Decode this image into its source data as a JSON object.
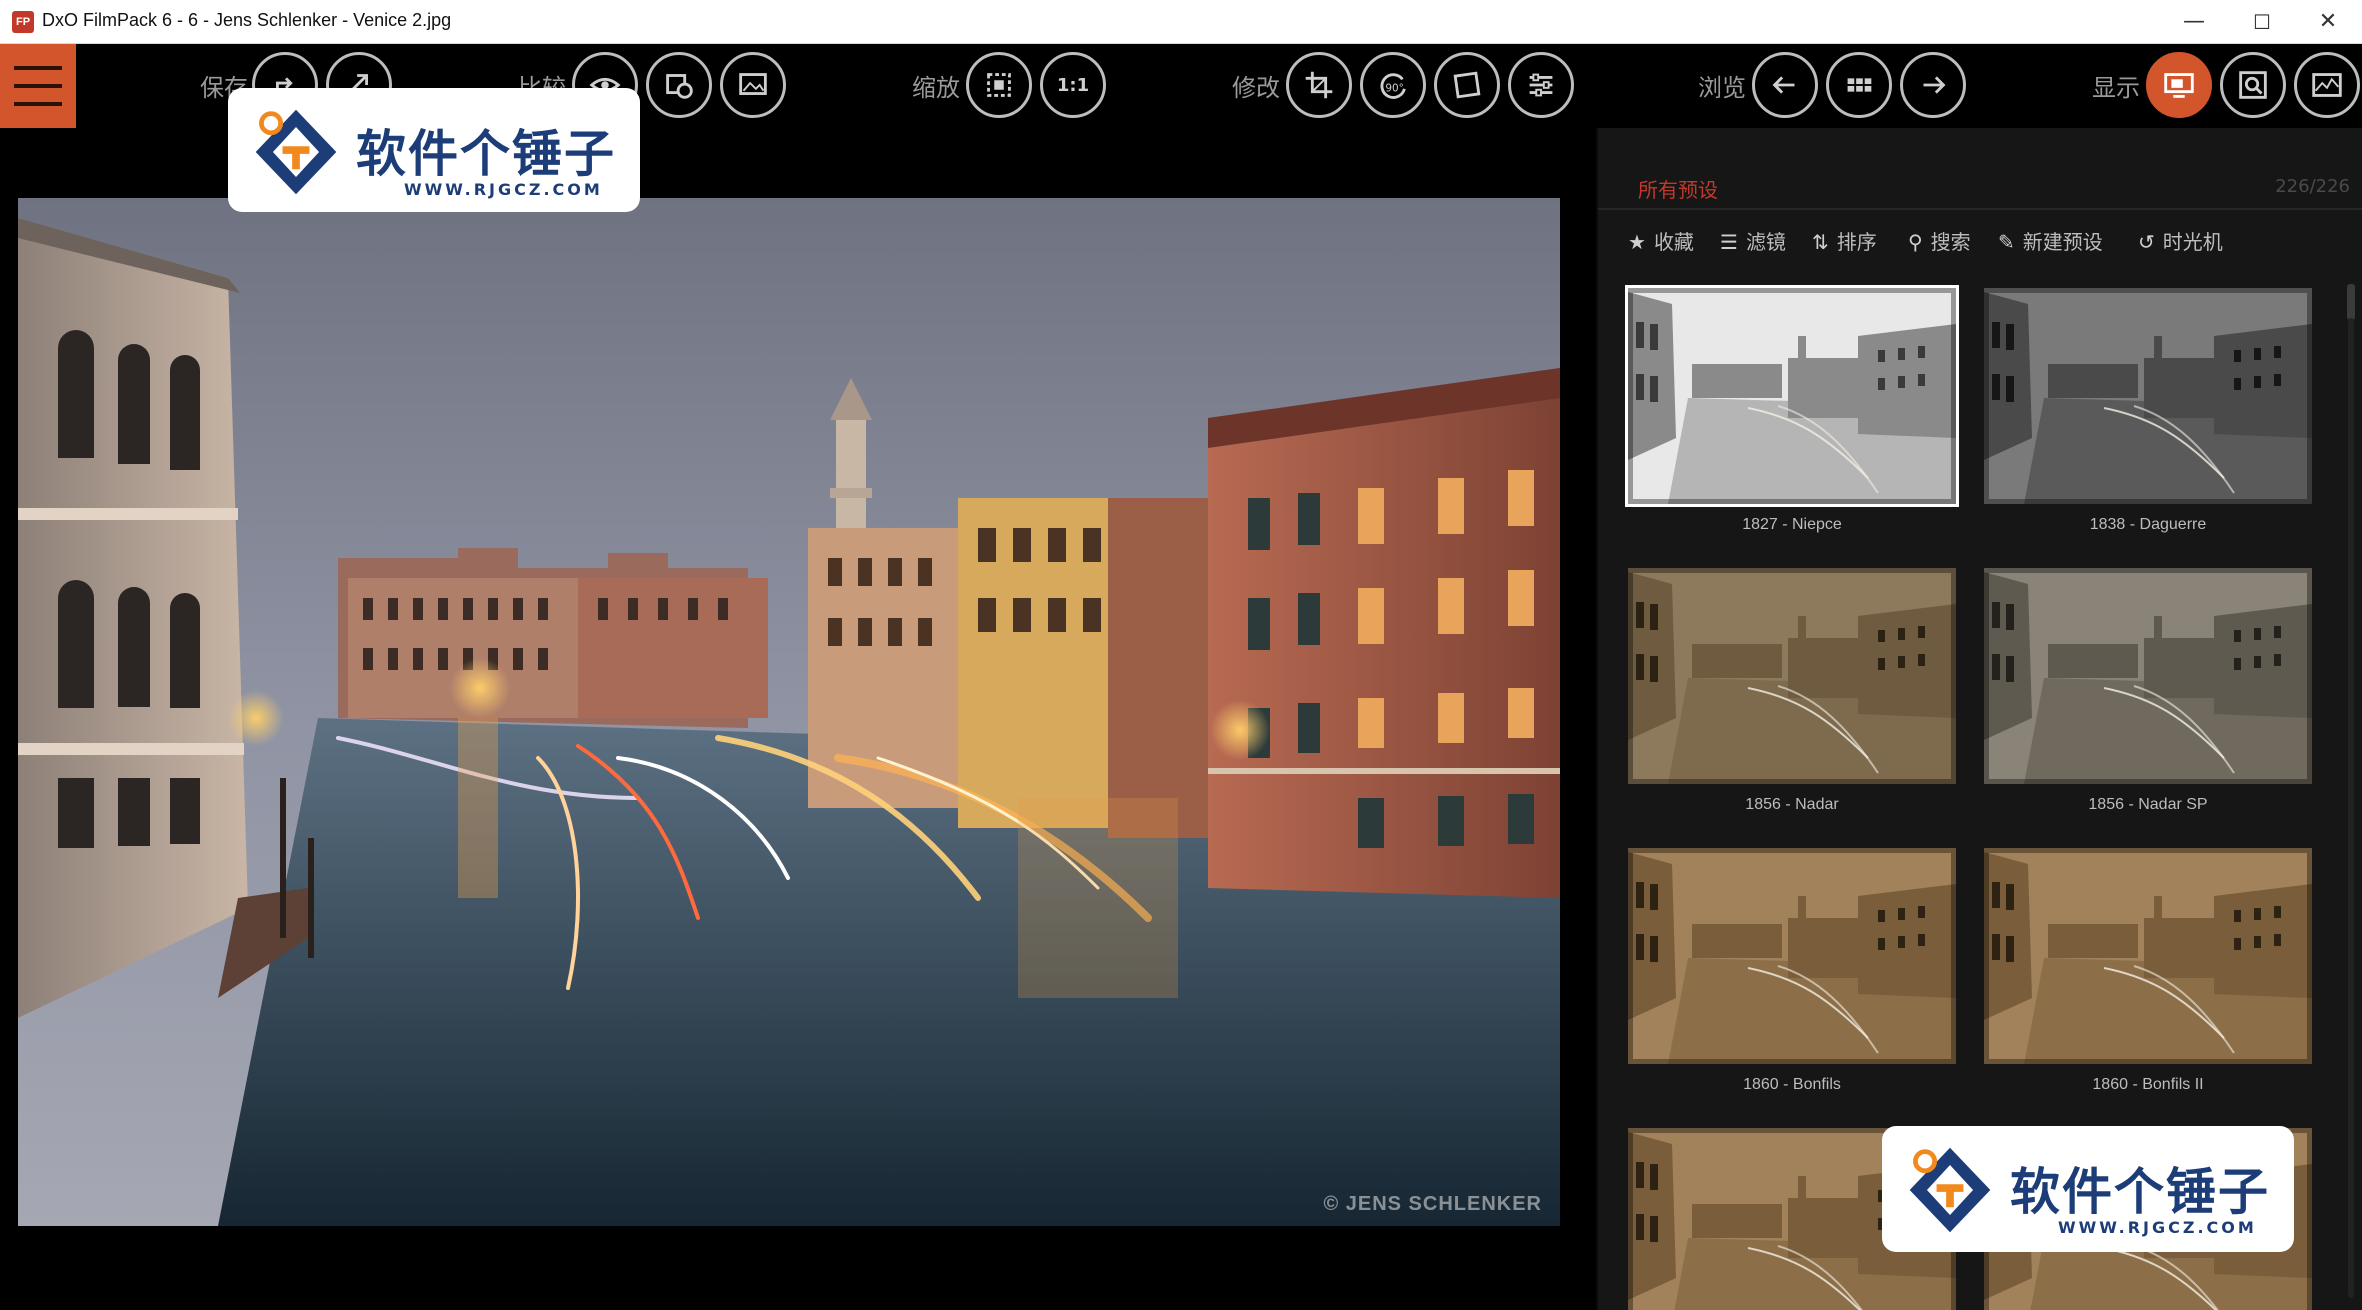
{
  "window": {
    "app_icon": "FP",
    "title": "DxO FilmPack 6 - 6 - Jens Schlenker - Venice 2.jpg",
    "minimize": "—",
    "maximize": "☐",
    "close": "✕"
  },
  "toolbar": {
    "menu_icon": "hamburger-icon",
    "groups": {
      "save": "保存",
      "compare": "比较",
      "zoom": "缩放",
      "modify": "修改",
      "browse": "浏览",
      "display": "显示"
    },
    "zoom_one_to_one": "1:1",
    "rotate_label": "90°",
    "accent_color": "#d2552b"
  },
  "watermark": {
    "text": "软件个锤子",
    "url": "WWW.RJGCZ.COM"
  },
  "photo": {
    "credit": "© JENS SCHLENKER"
  },
  "presets_panel": {
    "title": "所有预设",
    "count": "226/226",
    "tools": {
      "favorites": "收藏",
      "filter": "滤镜",
      "sort": "排序",
      "search": "搜索",
      "new_preset": "新建预设",
      "time_machine": "时光机"
    },
    "items": [
      {
        "label": "1827 - Niepce",
        "tone": "bw-light",
        "selected": true
      },
      {
        "label": "1838 - Daguerre",
        "tone": "bw-dark",
        "selected": false
      },
      {
        "label": "1856 - Nadar",
        "tone": "sepia",
        "selected": false
      },
      {
        "label": "1856 - Nadar SP",
        "tone": "sepia-grey",
        "selected": false
      },
      {
        "label": "1860 - Bonfils",
        "tone": "sepia-warm",
        "selected": false
      },
      {
        "label": "1860 - Bonfils II",
        "tone": "sepia-warm",
        "selected": false
      },
      {
        "label": "",
        "tone": "sepia-warm",
        "selected": false
      },
      {
        "label": "",
        "tone": "sepia-warm",
        "selected": false
      }
    ]
  }
}
